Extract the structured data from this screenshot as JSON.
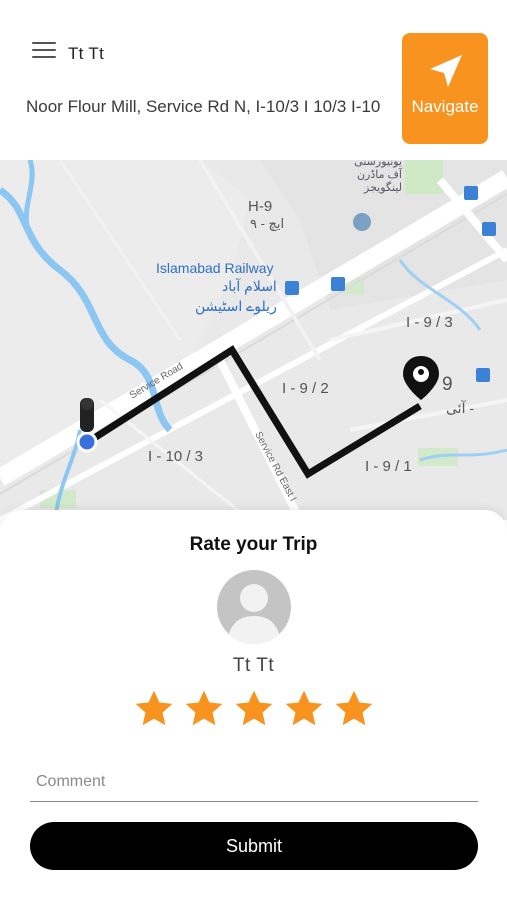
{
  "header": {
    "user_name": "Tt Tt",
    "address": "Noor Flour Mill,  Service Rd N,  I-10/3 I 10/3 I-10",
    "navigate_label": "Navigate"
  },
  "map": {
    "labels": {
      "h9": "H-9",
      "h9_urdu": "ایچ - ۹",
      "university_urdu": "یونیورسٹی\nآف ماڈرن\nلینگویجز",
      "railway": "Islamabad Railway",
      "railway_urdu_1": "اسلام آباد",
      "railway_urdu_2": "ریلوے اسٹیشن",
      "i93": "I - 9 / 3",
      "i92": "I - 9 / 2",
      "i91": "I - 9 / 1",
      "i103": "I - 10 / 3",
      "i9": "9",
      "i9_urdu": "آئی -",
      "service_road": "Service Road",
      "service_rd_east": "Service Rd East I"
    }
  },
  "rating": {
    "title": "Rate your Trip",
    "driver_name": "Tt Tt",
    "stars": 5,
    "comment_placeholder": "Comment",
    "submit_label": "Submit"
  },
  "colors": {
    "accent": "#f7931e",
    "star": "#f7931e",
    "route": "#111111",
    "map_bg": "#e9e9ea"
  }
}
